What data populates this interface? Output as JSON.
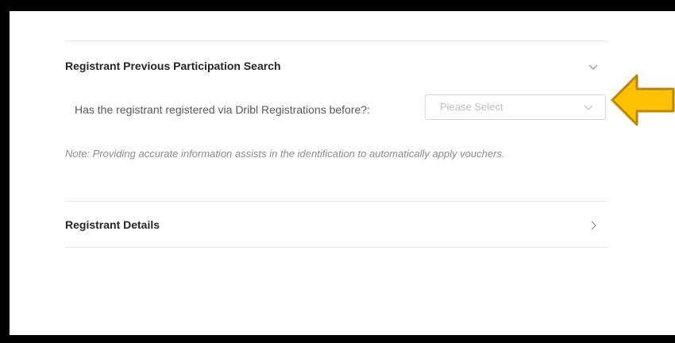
{
  "sections": {
    "previous_participation": {
      "title": "Registrant Previous Participation Search",
      "question": "Has the registrant registered via Dribl Registrations before?:",
      "select_placeholder": "Please Select",
      "note": "Note: Providing accurate information assists in the identification to automatically apply vouchers."
    },
    "registrant_details": {
      "title": "Registrant Details"
    }
  },
  "colors": {
    "arrow_fill": "#FFC000",
    "arrow_stroke": "#B8860B",
    "frame_border": "#000000"
  },
  "icons": {
    "section1_toggle": "chevron-down-icon",
    "select_toggle": "chevron-down-icon",
    "section2_toggle": "chevron-right-icon",
    "annotation": "arrow-left-icon"
  }
}
